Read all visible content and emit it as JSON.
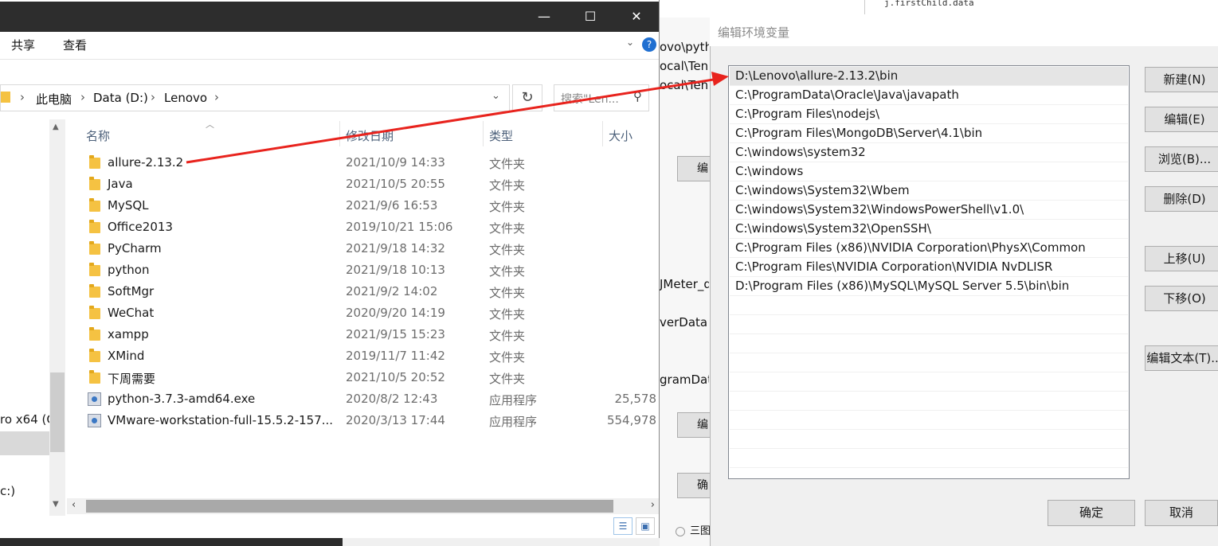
{
  "background": {
    "editor_snippet": "j.firstChild.data",
    "mid_texts": [
      "ovo\\pyth",
      "ocal\\Ten",
      "ocal\\Ten",
      "JMeter_d",
      "verData",
      "gramDat"
    ],
    "mid_buttons": [
      "编",
      "编",
      "确"
    ],
    "bottom_radio_label": "三图"
  },
  "explorer": {
    "window_controls": {
      "minimize": "—",
      "maximize": "☐",
      "close": "✕"
    },
    "ribbon_tabs": [
      "共享",
      "查看"
    ],
    "breadcrumb": [
      "此电脑",
      "Data (D:)",
      "Lenovo"
    ],
    "search_placeholder": "搜索\"Len...",
    "columns": {
      "name": "名称",
      "date": "修改日期",
      "type": "类型",
      "size": "大小"
    },
    "nav_fragments": [
      "ro x64 (C",
      "c:)"
    ],
    "files": [
      {
        "name": "allure-2.13.2",
        "date": "2021/10/9 14:33",
        "type": "文件夹",
        "size": "",
        "icon": "folder"
      },
      {
        "name": "Java",
        "date": "2021/10/5 20:55",
        "type": "文件夹",
        "size": "",
        "icon": "folder"
      },
      {
        "name": "MySQL",
        "date": "2021/9/6 16:53",
        "type": "文件夹",
        "size": "",
        "icon": "folder"
      },
      {
        "name": "Office2013",
        "date": "2019/10/21 15:06",
        "type": "文件夹",
        "size": "",
        "icon": "folder"
      },
      {
        "name": "PyCharm",
        "date": "2021/9/18 14:32",
        "type": "文件夹",
        "size": "",
        "icon": "folder"
      },
      {
        "name": "python",
        "date": "2021/9/18 10:13",
        "type": "文件夹",
        "size": "",
        "icon": "folder"
      },
      {
        "name": "SoftMgr",
        "date": "2021/9/2 14:02",
        "type": "文件夹",
        "size": "",
        "icon": "folder"
      },
      {
        "name": "WeChat",
        "date": "2020/9/20 14:19",
        "type": "文件夹",
        "size": "",
        "icon": "folder"
      },
      {
        "name": "xampp",
        "date": "2021/9/15 15:23",
        "type": "文件夹",
        "size": "",
        "icon": "folder"
      },
      {
        "name": "XMind",
        "date": "2019/11/7 11:42",
        "type": "文件夹",
        "size": "",
        "icon": "folder"
      },
      {
        "name": "下周需要",
        "date": "2021/10/5 20:52",
        "type": "文件夹",
        "size": "",
        "icon": "folder"
      },
      {
        "name": "python-3.7.3-amd64.exe",
        "date": "2020/8/2 12:43",
        "type": "应用程序",
        "size": "25,578",
        "icon": "exe"
      },
      {
        "name": "VMware-workstation-full-15.5.2-157...",
        "date": "2020/3/13 17:44",
        "type": "应用程序",
        "size": "554,978",
        "icon": "exe"
      }
    ]
  },
  "env_dialog": {
    "title": "编辑环境变量",
    "entries": [
      "D:\\Lenovo\\allure-2.13.2\\bin",
      "C:\\ProgramData\\Oracle\\Java\\javapath",
      "C:\\Program Files\\nodejs\\",
      "C:\\Program Files\\MongoDB\\Server\\4.1\\bin",
      "C:\\windows\\system32",
      "C:\\windows",
      "C:\\windows\\System32\\Wbem",
      "C:\\windows\\System32\\WindowsPowerShell\\v1.0\\",
      "C:\\windows\\System32\\OpenSSH\\",
      "C:\\Program Files (x86)\\NVIDIA Corporation\\PhysX\\Common",
      "C:\\Program Files\\NVIDIA Corporation\\NVIDIA NvDLISR",
      "D:\\Program Files (x86)\\MySQL\\MySQL Server 5.5\\bin\\bin"
    ],
    "buttons": {
      "new": "新建(N)",
      "edit": "编辑(E)",
      "browse": "浏览(B)...",
      "delete": "删除(D)",
      "move_up": "上移(U)",
      "move_down": "下移(O)",
      "edit_text": "编辑文本(T)..."
    },
    "ok": "确定",
    "cancel": "取消"
  },
  "colors": {
    "arrow": "#e8231d",
    "titlebar": "#2d2d2d",
    "selected_row": "#e5e5e5"
  }
}
